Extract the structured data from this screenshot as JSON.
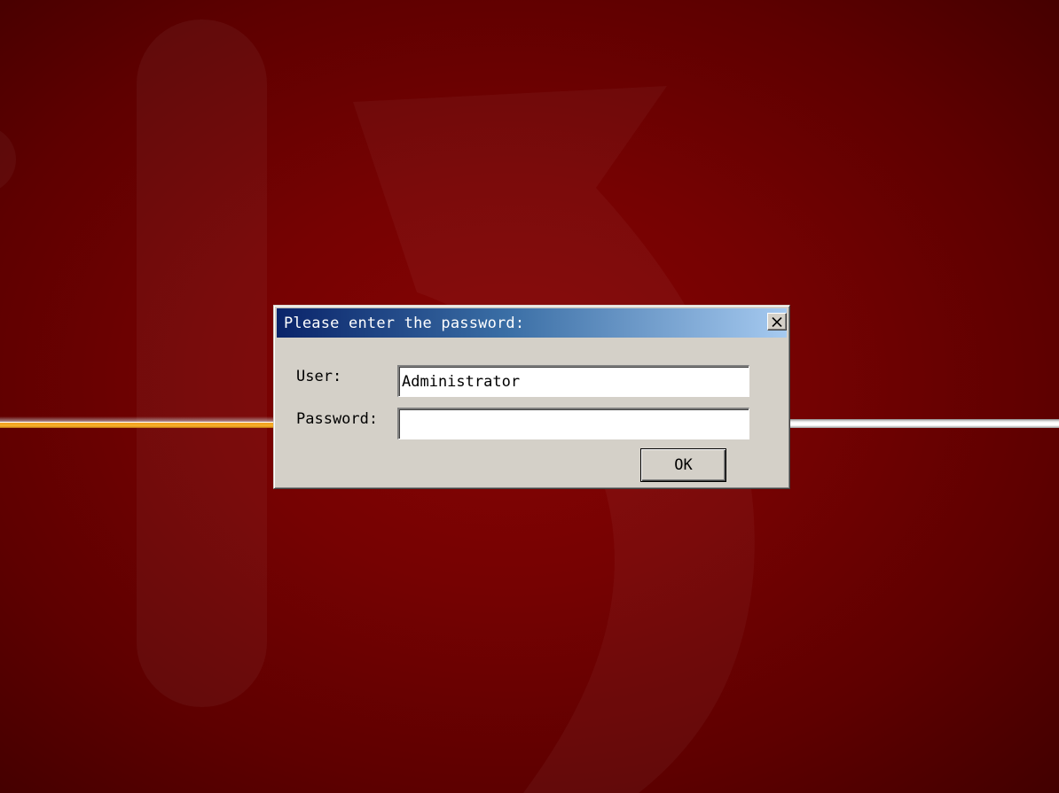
{
  "dialog": {
    "title": "Please enter the password:",
    "close_icon": "close-icon",
    "user_label": "User:",
    "user_value": "Administrator",
    "password_label": "Password:",
    "password_value": "",
    "ok_label": "OK"
  },
  "colors": {
    "desktop_background": "#760202",
    "titlebar_start": "#0a246a",
    "titlebar_end": "#a6caf0",
    "dialog_face": "#d4d0c8",
    "accent_stripe": "#f7b02a"
  }
}
